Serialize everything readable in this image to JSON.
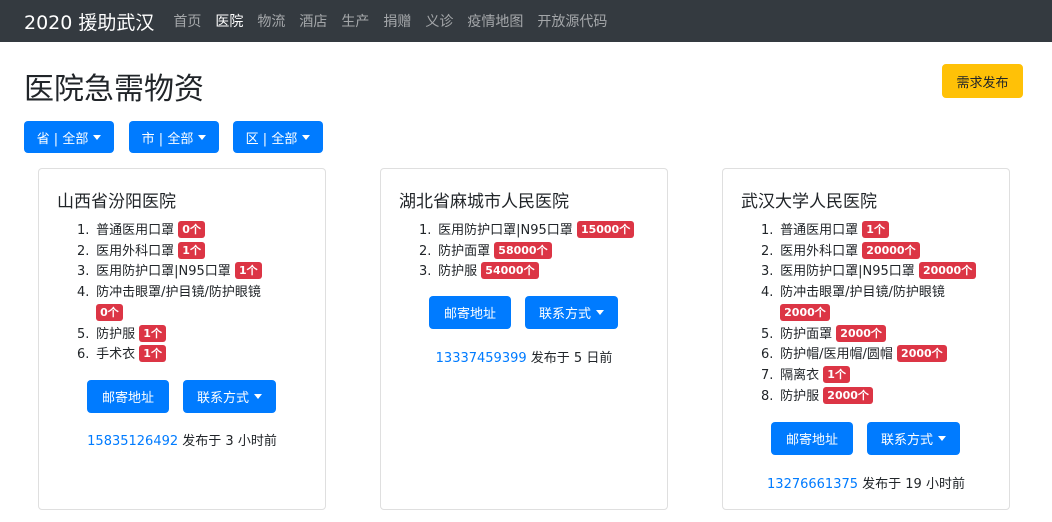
{
  "navbar": {
    "brand": "2020 援助武汉",
    "items": [
      "首页",
      "医院",
      "物流",
      "酒店",
      "生产",
      "捐赠",
      "义诊",
      "疫情地图",
      "开放源代码"
    ]
  },
  "page_title": "医院急需物资",
  "publish_button": "需求发布",
  "filters": {
    "province": "省 | 全部",
    "city": "市 | 全部",
    "district": "区 | 全部"
  },
  "colors": {
    "primary": "#007bff",
    "warning": "#ffc107",
    "danger": "#dc3545",
    "navbar": "#343a40"
  },
  "hospitals": [
    {
      "name": "山西省汾阳医院",
      "needs": [
        {
          "item": "普通医用口罩",
          "qty": "0个"
        },
        {
          "item": "医用外科口罩",
          "qty": "1个"
        },
        {
          "item": "医用防护口罩|N95口罩",
          "qty": "1个"
        },
        {
          "item": "防冲击眼罩/护目镜/防护眼镜",
          "qty": "0个"
        },
        {
          "item": "防护服",
          "qty": "1个"
        },
        {
          "item": "手术衣",
          "qty": "1个"
        }
      ],
      "mail_button": "邮寄地址",
      "contact_button": "联系方式",
      "phone": "15835126492",
      "posted": "发布于 3 小时前"
    },
    {
      "name": "湖北省麻城市人民医院",
      "needs": [
        {
          "item": "医用防护口罩|N95口罩",
          "qty": "15000个"
        },
        {
          "item": "防护面罩",
          "qty": "58000个"
        },
        {
          "item": "防护服",
          "qty": "54000个"
        }
      ],
      "mail_button": "邮寄地址",
      "contact_button": "联系方式",
      "phone": "13337459399",
      "posted": "发布于 5 日前"
    },
    {
      "name": "武汉大学人民医院",
      "needs": [
        {
          "item": "普通医用口罩",
          "qty": "1个"
        },
        {
          "item": "医用外科口罩",
          "qty": "20000个"
        },
        {
          "item": "医用防护口罩|N95口罩",
          "qty": "20000个"
        },
        {
          "item": "防冲击眼罩/护目镜/防护眼镜",
          "qty": "2000个"
        },
        {
          "item": "防护面罩",
          "qty": "2000个"
        },
        {
          "item": "防护帽/医用帽/圆帽",
          "qty": "2000个"
        },
        {
          "item": "隔离衣",
          "qty": "1个"
        },
        {
          "item": "防护服",
          "qty": "2000个"
        }
      ],
      "mail_button": "邮寄地址",
      "contact_button": "联系方式",
      "phone": "13276661375",
      "posted": "发布于 19 小时前"
    }
  ]
}
